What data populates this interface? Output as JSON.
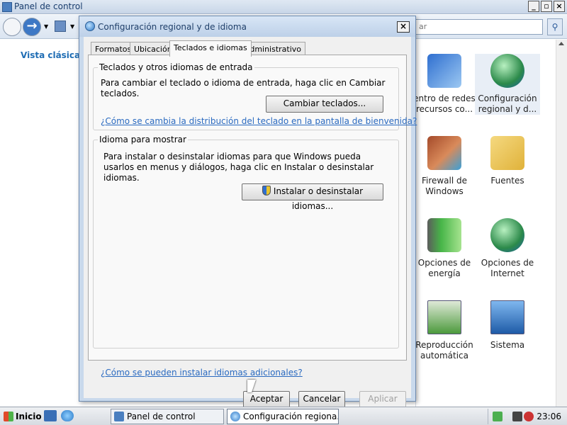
{
  "control_panel": {
    "title": "Panel de control",
    "search_placeholder": "ar",
    "classic_view": "Vista clásica",
    "items": [
      {
        "label": "entro de redes recursos co...",
        "icon": "network-center-icon"
      },
      {
        "label": "Configuración regional y d...",
        "icon": "regional-settings-globe-icon"
      },
      {
        "label": "Firewall de Windows",
        "icon": "firewall-brick-globe-icon"
      },
      {
        "label": "Fuentes",
        "icon": "fonts-folder-icon"
      },
      {
        "label": "Opciones de energía",
        "icon": "power-battery-icon"
      },
      {
        "label": "Opciones de Internet",
        "icon": "internet-options-globe-icon"
      },
      {
        "label": "Reproducción automática",
        "icon": "autoplay-icon"
      },
      {
        "label": "Sistema",
        "icon": "system-computer-icon"
      }
    ]
  },
  "dialog": {
    "title": "Configuración regional y de idioma",
    "tabs": [
      "Formatos",
      "Ubicación",
      "Teclados e idiomas",
      "Administrativo"
    ],
    "active_tab": "Teclados e idiomas",
    "keyboards_group": {
      "legend": "Teclados y otros idiomas de entrada",
      "text": "Para cambiar el teclado o idioma de entrada, haga clic en Cambiar teclados.",
      "button": "Cambiar teclados...",
      "link": "¿Cómo se cambia la distribución del teclado en la pantalla de bienvenida?"
    },
    "display_language_group": {
      "legend": "Idioma para mostrar",
      "text": "Para instalar o desinstalar idiomas para que Windows pueda usarlos en menus y diálogos, haga clic en Instalar o desinstalar idiomas.",
      "button": "Instalar o desinstalar idiomas..."
    },
    "bottom_link": "¿Cómo se pueden instalar idiomas adicionales?",
    "buttons": {
      "ok": "Aceptar",
      "cancel": "Cancelar",
      "apply": "Aplicar"
    }
  },
  "taskbar": {
    "start": "Inicio",
    "tasks": [
      "Panel de control",
      "Configuración regiona..."
    ],
    "clock": "23:06"
  },
  "colors": {
    "link": "#2a6ac0",
    "classic_view": "#1f6db4"
  }
}
